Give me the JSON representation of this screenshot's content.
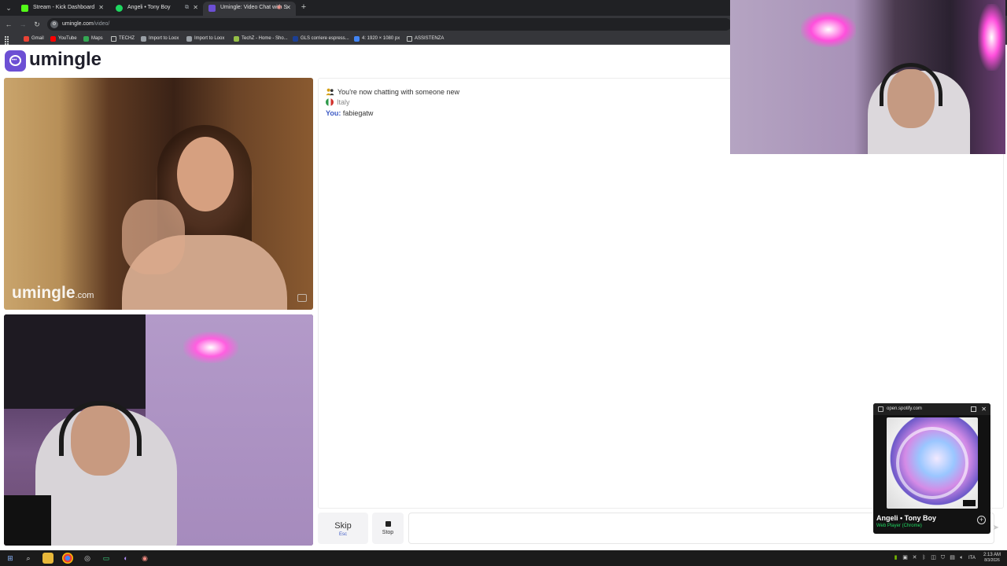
{
  "browser": {
    "tabs": [
      {
        "title": "Stream - Kick Dashboard",
        "favicon_color": "#53fc18",
        "active": false
      },
      {
        "title": "Angeli • Tony Boy",
        "favicon_color": "#1ed760",
        "active": false
      },
      {
        "title": "Umingle: Video Chat with S",
        "favicon_color": "#6c4fd4",
        "active": true
      }
    ],
    "url": {
      "host": "umingle.com",
      "path": "/video/"
    },
    "bookmarks": [
      {
        "label": "Gmail",
        "icon_color": "#ea4335"
      },
      {
        "label": "YouTube",
        "icon_color": "#ff0000"
      },
      {
        "label": "Maps",
        "icon_color": "#34a853"
      },
      {
        "label": "TECHZ",
        "icon": "folder"
      },
      {
        "label": "Import to Loox",
        "icon_color": "#9aa0a6"
      },
      {
        "label": "Import to Loox",
        "icon_color": "#9aa0a6"
      },
      {
        "label": "TechZ - Home - Sho...",
        "icon_color": "#95bf47"
      },
      {
        "label": "GLS corriere espress...",
        "icon_color": "#1c3f94"
      },
      {
        "label": "4: 1920 × 1080 px",
        "icon_color": "#4285f4"
      },
      {
        "label": "ASSISTENZA",
        "icon": "folder"
      }
    ]
  },
  "app": {
    "logo_text": "umingle",
    "brand_color": "#6c4fd4",
    "watermark": {
      "name": "umingle",
      "tld": ".com"
    }
  },
  "chat": {
    "system_message": "You're now chatting with someone new",
    "country": "Italy",
    "messages": [
      {
        "sender": "You:",
        "text": "fabiegatw"
      }
    ]
  },
  "controls": {
    "skip_label": "Skip",
    "skip_key": "Esc",
    "stop_label": "Stop",
    "input_value": ""
  },
  "spotify": {
    "site": "open.spotify.com",
    "track": "Angeli • Tony Boy",
    "source": "Web Player (Chrome)"
  },
  "taskbar": {
    "lang": "ITA",
    "time": "2:13 AM",
    "date": "8/3/2026"
  }
}
